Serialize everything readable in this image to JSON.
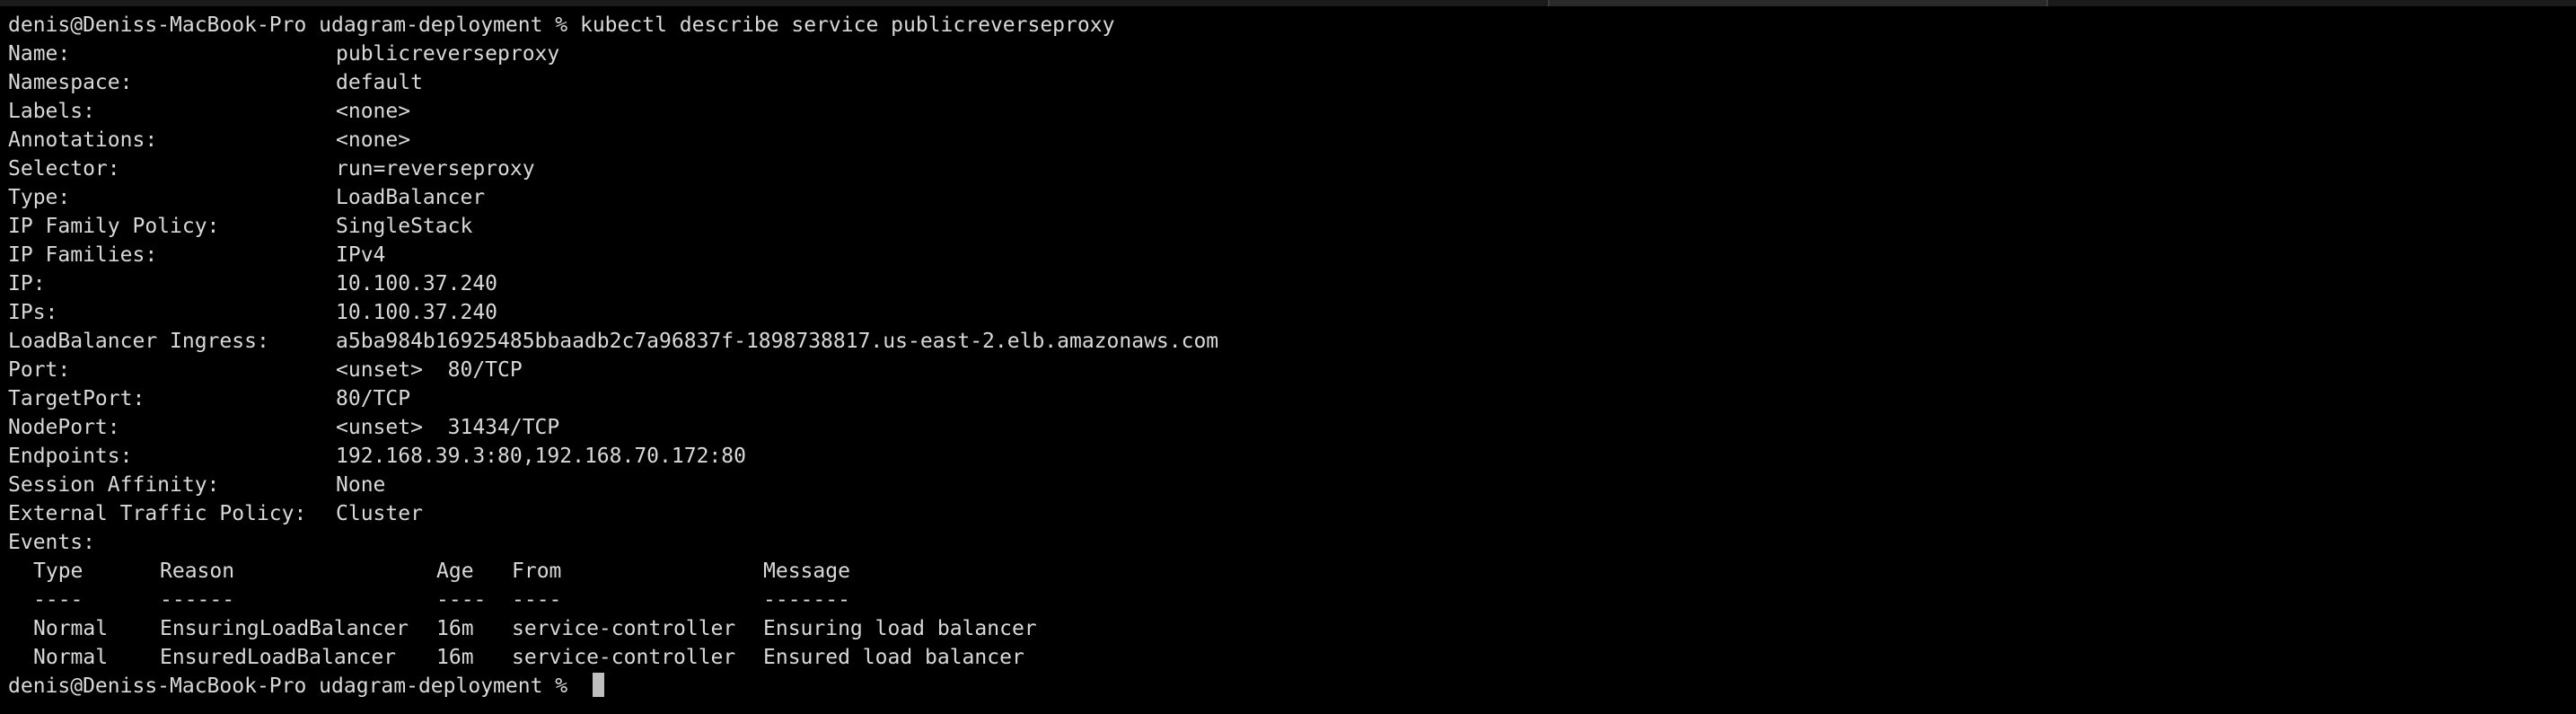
{
  "terminal": {
    "command_line": {
      "prompt": "denis@Deniss-MacBook-Pro udagram-deployment % ",
      "command": "kubectl describe service publicreverseproxy"
    },
    "fields": [
      {
        "key": "Name:",
        "value": "publicreverseproxy"
      },
      {
        "key": "Namespace:",
        "value": "default"
      },
      {
        "key": "Labels:",
        "value": "<none>"
      },
      {
        "key": "Annotations:",
        "value": "<none>"
      },
      {
        "key": "Selector:",
        "value": "run=reverseproxy"
      },
      {
        "key": "Type:",
        "value": "LoadBalancer"
      },
      {
        "key": "IP Family Policy:",
        "value": "SingleStack"
      },
      {
        "key": "IP Families:",
        "value": "IPv4"
      },
      {
        "key": "IP:",
        "value": "10.100.37.240"
      },
      {
        "key": "IPs:",
        "value": "10.100.37.240"
      },
      {
        "key": "LoadBalancer Ingress:",
        "value": "a5ba984b16925485bbaadb2c7a96837f-1898738817.us-east-2.elb.amazonaws.com"
      },
      {
        "key": "Port:",
        "value": "<unset>  80/TCP"
      },
      {
        "key": "TargetPort:",
        "value": "80/TCP"
      },
      {
        "key": "NodePort:",
        "value": "<unset>  31434/TCP"
      },
      {
        "key": "Endpoints:",
        "value": "192.168.39.3:80,192.168.70.172:80"
      },
      {
        "key": "Session Affinity:",
        "value": "None"
      },
      {
        "key": "External Traffic Policy:",
        "value": "Cluster"
      }
    ],
    "events": {
      "label": "Events:",
      "headers": [
        "Type",
        "Reason",
        "Age",
        "From",
        "Message"
      ],
      "separators": [
        "----",
        "------",
        "----",
        "----",
        "-------"
      ],
      "rows": [
        [
          "Normal",
          "EnsuringLoadBalancer",
          "16m",
          "service-controller",
          "Ensuring load balancer"
        ],
        [
          "Normal",
          "EnsuredLoadBalancer",
          "16m",
          "service-controller",
          "Ensured load balancer"
        ]
      ]
    },
    "final_prompt": "denis@Deniss-MacBook-Pro udagram-deployment % ",
    "colors": {
      "background": "#000000",
      "text": "#d9d9d9",
      "cursor": "#bfbfbf"
    }
  }
}
